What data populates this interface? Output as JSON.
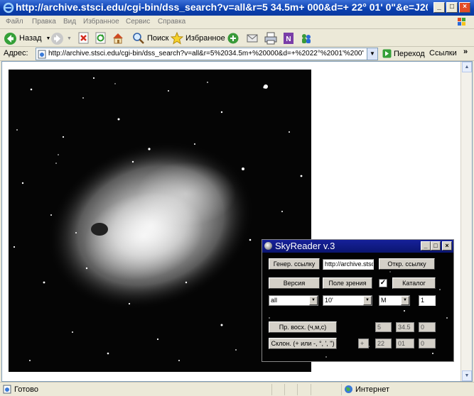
{
  "window": {
    "title": "http://archive.stsci.edu/cgi-bin/dss_search?v=all&r=5 34.5m+ 000&d=+ 22° 01' 0\"&e=J200..."
  },
  "menu": {
    "items": [
      "Файл",
      "Правка",
      "Вид",
      "Избранное",
      "Сервис",
      "Справка"
    ]
  },
  "toolbar": {
    "back_label": "Назад",
    "search_label": "Поиск",
    "favorites_label": "Избранное"
  },
  "address": {
    "label": "Адрес:",
    "url": "http://archive.stsci.edu/cgi-bin/dss_search?v=all&r=5%2034.5m+%20000&d=+%2022°%2001'%200\"&e",
    "go_label": "Переход",
    "links_label": "Ссылки",
    "chevron": "»"
  },
  "status": {
    "text": "Готово",
    "zone": "Интернет"
  },
  "skyreader": {
    "title": "SkyReader v.3",
    "gen_link_label": "Генер. ссылку",
    "link_value": "http://archive.stsc",
    "open_link_label": "Откр. ссылку",
    "version_label": "Версия",
    "fov_label": "Поле зрения",
    "catalog_label": "Каталог",
    "survey_value": "all",
    "fov_value": "10'",
    "unit_value": "M",
    "count_value": "1",
    "ra_label": "Пр. восх. (ч,м,с)",
    "ra_h": "5",
    "ra_m": "34.5",
    "ra_s": "0",
    "dec_label": "Склон. (+ или -, °, ', \")",
    "dec_sign": "+",
    "dec_d": "22",
    "dec_m": "01",
    "dec_s": "0"
  }
}
